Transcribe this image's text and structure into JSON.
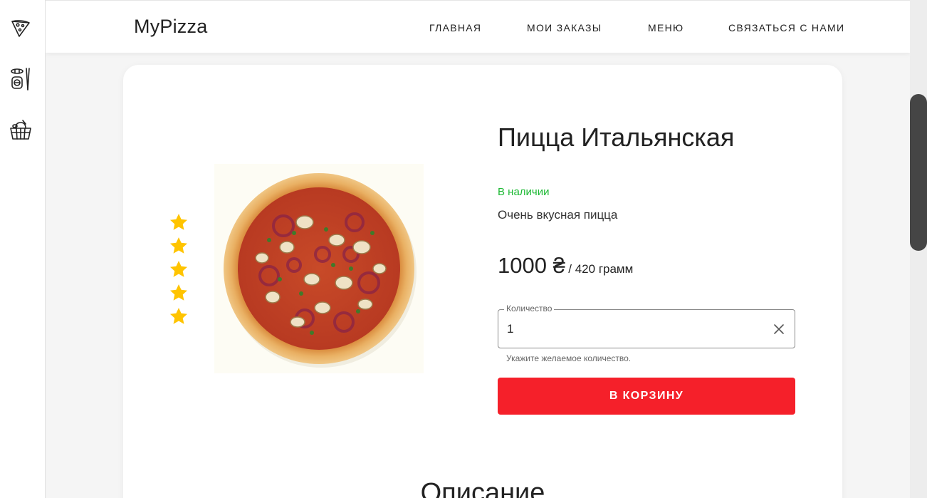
{
  "colors": {
    "accent_red": "#f5202a",
    "stock_green": "#1db934",
    "star_gold": "#ffc400",
    "scroll_thumb": "#454545"
  },
  "sidebar": {
    "items": [
      {
        "name": "pizza-slice-icon"
      },
      {
        "name": "sushi-chopsticks-icon"
      },
      {
        "name": "food-basket-icon"
      }
    ]
  },
  "header": {
    "brand": "MyPizza",
    "nav": [
      "ГЛАВНАЯ",
      "МОИ ЗАКАЗЫ",
      "МЕНЮ",
      "СВЯЗАТЬСЯ С НАМИ"
    ]
  },
  "product": {
    "title": "Пицца Итальянская",
    "availability": "В наличии",
    "description": "Очень вкусная пицца",
    "price": "1000 ₴",
    "weight": "/ 420 грамм",
    "rating": 5,
    "rating_max": 5,
    "image_icon": "pizza-image"
  },
  "quantity": {
    "label": "Количество",
    "value": "1",
    "hint": "Укажите желаемое количество."
  },
  "buttons": {
    "add_to_cart": "В КОРЗИНУ"
  },
  "section": {
    "description_title": "Описание"
  }
}
